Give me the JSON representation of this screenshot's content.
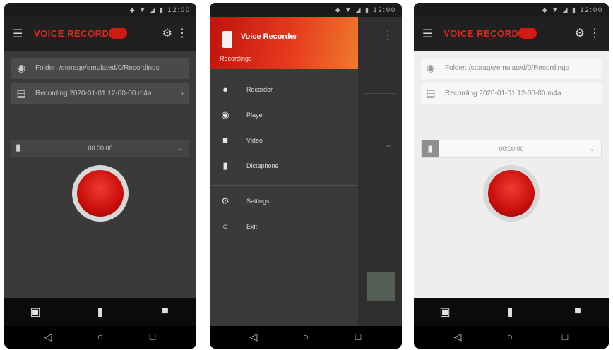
{
  "screens": [
    {
      "theme": "dark",
      "status_icons": "◆ ▼ ◢ ▮ 12:00",
      "app_title": "VOICE RECORDER",
      "fields": [
        {
          "icon": "location-pin-icon",
          "glyph": "◉",
          "text": "Folder: /storage/emulated/0/Recordings"
        },
        {
          "icon": "file-icon",
          "glyph": "▤",
          "text": "Recording 2020-01-01 12-00-00.m4a"
        }
      ],
      "timer_label": "00:00:00",
      "tabs": [
        "▣",
        "▮",
        "■"
      ],
      "nav": [
        "◁",
        "○",
        "□"
      ]
    },
    {
      "theme": "drawer",
      "status_icons": "◆ ▼ ◢ ▮ 12:00",
      "drawer_title": "Voice Recorder",
      "drawer_subtitle": "Recordings",
      "drawer_items": [
        {
          "icon": "microphone-icon",
          "glyph": "●",
          "label": "Recorder"
        },
        {
          "icon": "eye-icon",
          "glyph": "◉",
          "label": "Player"
        },
        {
          "icon": "video-icon",
          "glyph": "■",
          "label": "Video"
        },
        {
          "icon": "microphone-icon",
          "glyph": "▮",
          "label": "Dictaphone"
        },
        {
          "icon": "gear-icon",
          "glyph": "⚙",
          "label": "Settings"
        },
        {
          "icon": "exit-icon",
          "glyph": "○",
          "label": "Exit"
        }
      ],
      "nav": [
        "◁",
        "○",
        "□"
      ]
    },
    {
      "theme": "light",
      "status_icons": "◆ ▼ ◢ ▮ 12:00",
      "app_title": "VOICE RECORDER",
      "fields": [
        {
          "icon": "location-pin-icon",
          "glyph": "◉",
          "text": "Folder: /storage/emulated/0/Recordings"
        },
        {
          "icon": "file-icon",
          "glyph": "▤",
          "text": "Recording 2020-01-01 12-00-00.m4a"
        }
      ],
      "timer_label": "00:00:00",
      "tabs": [
        "▣",
        "▮",
        "■"
      ],
      "nav": [
        "◁",
        "○",
        "□"
      ]
    }
  ]
}
